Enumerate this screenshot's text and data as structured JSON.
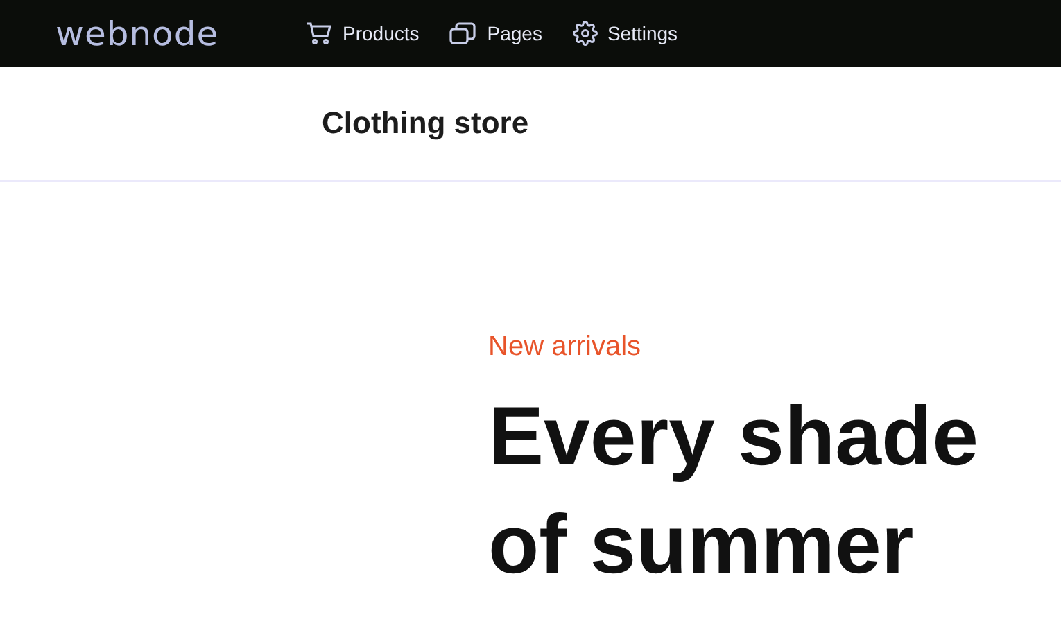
{
  "top_bar": {
    "logo": "webnode",
    "nav": [
      {
        "label": "Products",
        "kind": "cart"
      },
      {
        "label": "Pages",
        "kind": "pages"
      },
      {
        "label": "Settings",
        "kind": "gear"
      }
    ]
  },
  "header": {
    "site_title": "Clothing store"
  },
  "hero": {
    "eyebrow": "New arrivals",
    "heading": "Every shade of summer"
  }
}
